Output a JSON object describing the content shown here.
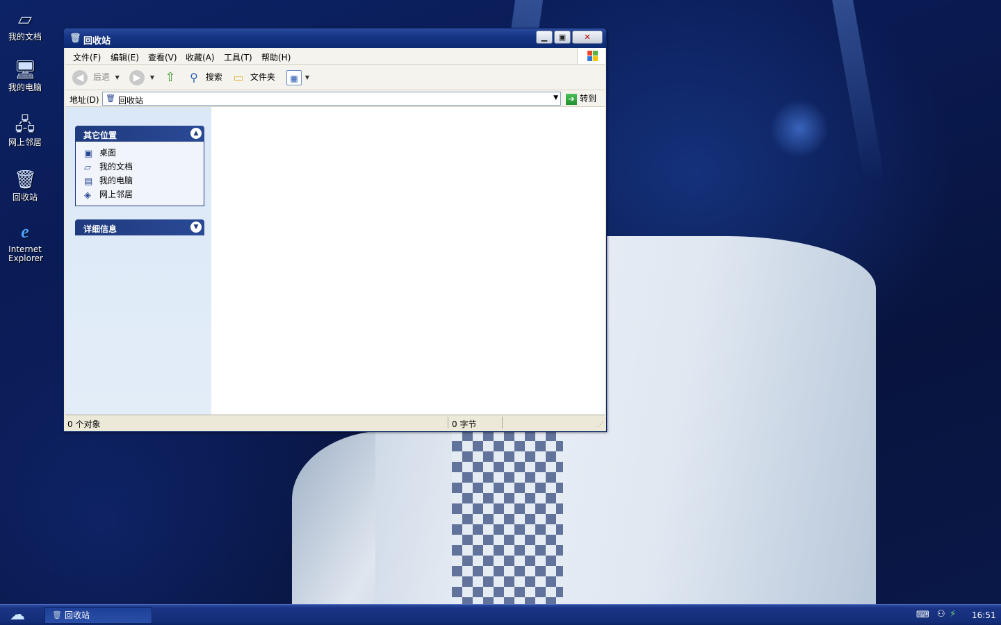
{
  "desktop": {
    "icons": [
      {
        "label": "我的文档"
      },
      {
        "label": "我的电脑"
      },
      {
        "label": "网上邻居"
      },
      {
        "label": "回收站"
      },
      {
        "label": "Internet Explorer"
      }
    ]
  },
  "window": {
    "title": "回收站",
    "menu": [
      "文件(F)",
      "编辑(E)",
      "查看(V)",
      "收藏(A)",
      "工具(T)",
      "帮助(H)"
    ],
    "toolbar": {
      "back": "后退",
      "search": "搜索",
      "folders": "文件夹"
    },
    "address": {
      "label": "地址(D)",
      "value": "回收站",
      "go": "转到"
    },
    "taskpane": {
      "other_places": {
        "title": "其它位置",
        "items": [
          "桌面",
          "我的文档",
          "我的电脑",
          "网上邻居"
        ]
      },
      "details": {
        "title": "详细信息"
      }
    },
    "status": {
      "objects": "0 个对象",
      "size": "0 字节"
    }
  },
  "taskbar": {
    "task": "回收站",
    "clock": "16:51"
  },
  "colors": {
    "titlebar": "#163685",
    "taskbar": "#142d78",
    "taskpane_head": "#1f3a7e"
  }
}
